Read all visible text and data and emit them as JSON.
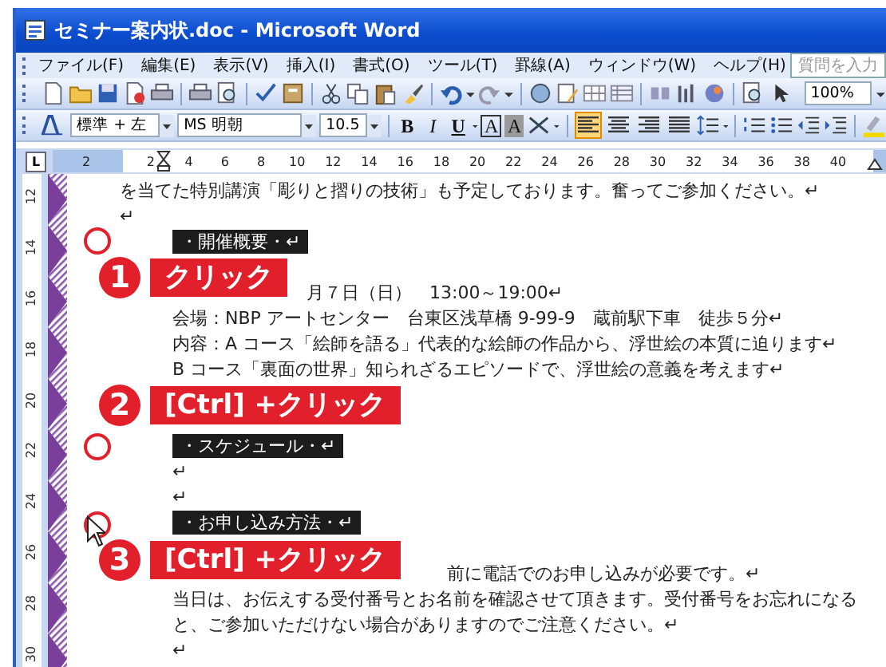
{
  "window": {
    "title": "セミナー案内状.doc - Microsoft Word"
  },
  "menu_bar": [
    "ファイル(F)",
    "編集(E)",
    "表示(V)",
    "挿入(I)",
    "書式(O)",
    "ツール(T)",
    "罫線(A)",
    "ウィンドウ(W)",
    "ヘルプ(H)"
  ],
  "help_search": {
    "placeholder": "質問を入力"
  },
  "standard_toolbar": {
    "zoom": "100%"
  },
  "formatting_toolbar": {
    "style": "標準 + 左",
    "font": "MS 明朝",
    "size": "10.5",
    "text_buttons": [
      "B",
      "I",
      "U",
      "A",
      "A"
    ],
    "alignment": [
      {
        "selected": true
      },
      {
        "selected": false
      },
      {
        "selected": false
      },
      {
        "selected": false
      }
    ]
  },
  "ruler": {
    "tab_selector": "L",
    "numbers": [
      "2",
      "2",
      "4",
      "6",
      "8",
      "10",
      "12",
      "14",
      "16",
      "18",
      "20",
      "22",
      "24",
      "26",
      "28",
      "30",
      "32",
      "34",
      "36",
      "38",
      "40"
    ]
  },
  "vertical_ruler": {
    "numbers": [
      "12",
      "14",
      "16",
      "18",
      "20",
      "22",
      "24",
      "26",
      "28",
      "30"
    ]
  },
  "document": {
    "lines": [
      {
        "kind": "body",
        "text": "を当てた特別講演「彫りと摺りの技術」も予定しております。奮ってご参加ください。↵"
      },
      {
        "kind": "body",
        "text": "↵"
      },
      {
        "kind": "heading",
        "text": "・開催概要・↵",
        "selected": true
      },
      {
        "kind": "gap"
      },
      {
        "kind": "tail",
        "text": "月７日（日）　13:00～19:00↵"
      },
      {
        "kind": "indent",
        "text": "会場：NBP アートセンター　台東区浅草橋 9-99-9　蔵前駅下車　徒歩５分↵"
      },
      {
        "kind": "indent",
        "text": "内容：A コース「絵師を語る」代表的な絵師の作品から、浮世絵の本質に迫ります↵"
      },
      {
        "kind": "indent",
        "text": "B コース「裏面の世界」知られざるエピソードで、浮世絵の意義を考えます↵"
      },
      {
        "kind": "gap"
      },
      {
        "kind": "gap"
      },
      {
        "kind": "heading",
        "text": "・スケジュール・↵",
        "selected": true
      },
      {
        "kind": "indent",
        "text": "↵"
      },
      {
        "kind": "indent",
        "text": "↵"
      },
      {
        "kind": "heading",
        "text": "・お申し込み方法・↵",
        "selected": true
      },
      {
        "kind": "gap"
      },
      {
        "kind": "tail",
        "text": "前に電話でのお申し込みが必要です。↵"
      },
      {
        "kind": "indent",
        "text": "当日は、お伝えする受付番号とお名前を確認させて頂きます。受付番号をお忘れになる"
      },
      {
        "kind": "indent",
        "text": "と、ご参加いただけない場合がありますのでご注意ください。↵"
      },
      {
        "kind": "indent",
        "text": "↵"
      }
    ]
  },
  "callouts": [
    {
      "number": "1",
      "label": "クリック"
    },
    {
      "number": "2",
      "label": "[Ctrl] +クリック"
    },
    {
      "number": "3",
      "label": "[Ctrl] +クリック"
    }
  ]
}
